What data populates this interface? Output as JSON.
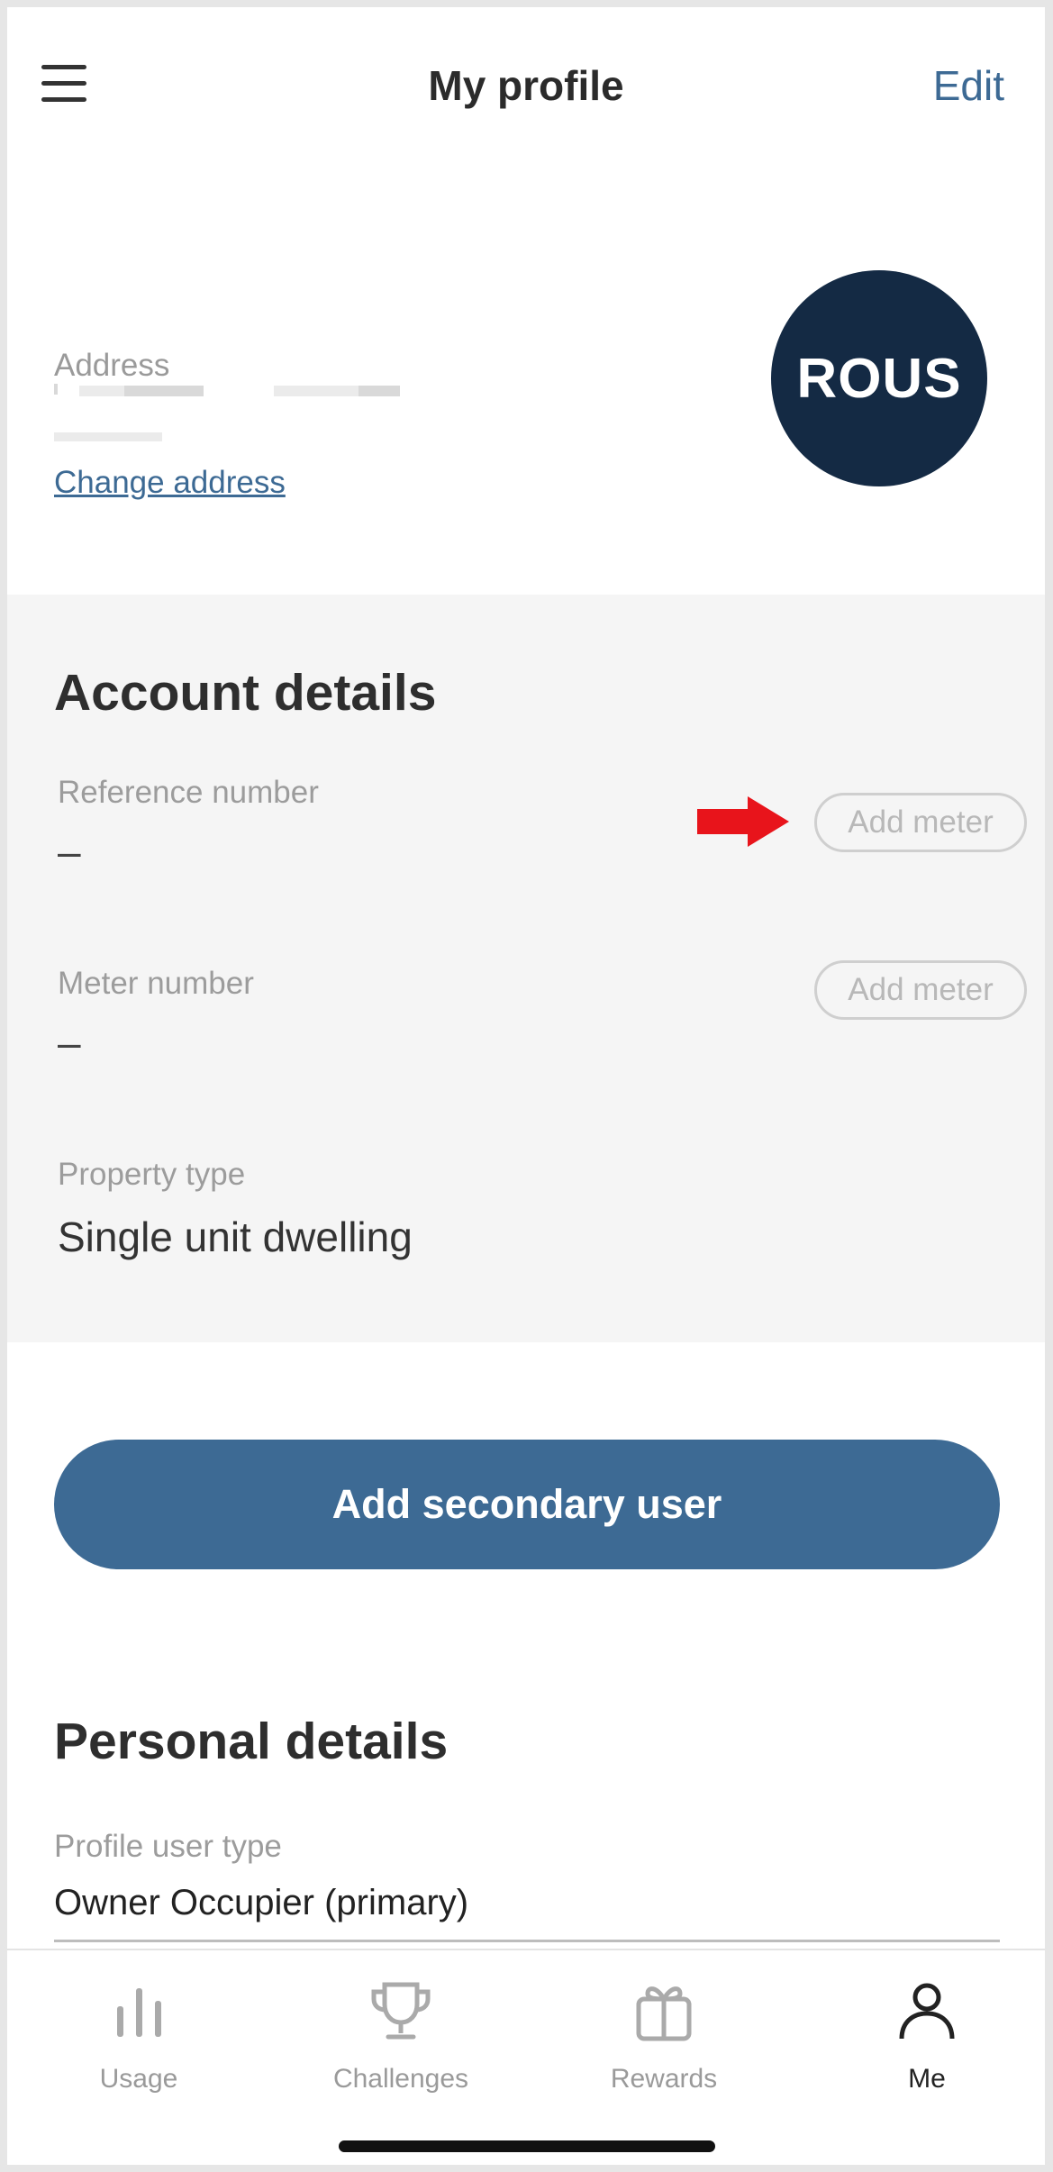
{
  "header": {
    "title": "My profile",
    "edit_label": "Edit"
  },
  "address": {
    "label": "Address",
    "change_link": "Change address"
  },
  "logo": {
    "text": "ROUS",
    "background": "#142a44"
  },
  "account_details": {
    "title": "Account details",
    "reference": {
      "label": "Reference number",
      "value": "–",
      "button": "Add meter"
    },
    "meter": {
      "label": "Meter number",
      "value": "–",
      "button": "Add meter"
    },
    "property": {
      "label": "Property type",
      "value": "Single unit dwelling"
    }
  },
  "secondary_user_button": "Add secondary user",
  "personal_details": {
    "title": "Personal details",
    "profile_user_type": {
      "label": "Profile user type",
      "value": "Owner Occupier (primary)"
    }
  },
  "tabs": [
    {
      "label": "Usage",
      "icon": "usage-bars-icon"
    },
    {
      "label": "Challenges",
      "icon": "trophy-icon"
    },
    {
      "label": "Rewards",
      "icon": "gift-icon"
    },
    {
      "label": "Me",
      "icon": "person-icon",
      "active": true
    }
  ],
  "colors": {
    "accent": "#3d6a94",
    "arrow": "#e8141b"
  }
}
